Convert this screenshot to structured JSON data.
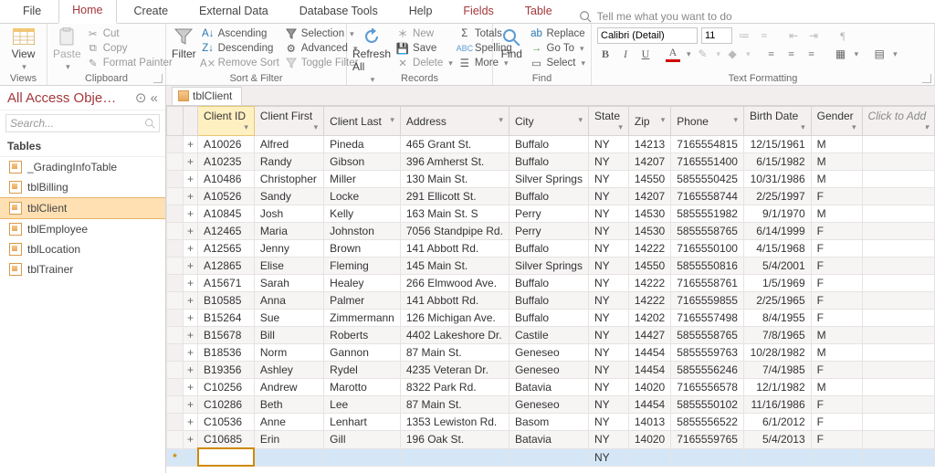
{
  "tabs": {
    "file": "File",
    "home": "Home",
    "create": "Create",
    "external": "External Data",
    "dbtools": "Database Tools",
    "help": "Help",
    "fields": "Fields",
    "table": "Table",
    "tellme": "Tell me what you want to do"
  },
  "ribbon": {
    "views": {
      "title": "Views",
      "view": "View"
    },
    "clipboard": {
      "title": "Clipboard",
      "paste": "Paste",
      "cut": "Cut",
      "copy": "Copy",
      "fp": "Format Painter"
    },
    "sortfilter": {
      "title": "Sort & Filter",
      "filter": "Filter",
      "asc": "Ascending",
      "desc": "Descending",
      "rs": "Remove Sort",
      "sel": "Selection",
      "adv": "Advanced",
      "tog": "Toggle Filter"
    },
    "records": {
      "title": "Records",
      "refresh": "Refresh All",
      "new": "New",
      "save": "Save",
      "delete": "Delete",
      "totals": "Totals",
      "spelling": "Spelling",
      "more": "More"
    },
    "find": {
      "title": "Find",
      "find": "Find",
      "replace": "Replace",
      "goto": "Go To",
      "select": "Select"
    },
    "fmt": {
      "title": "Text Formatting",
      "font": "Calibri (Detail)",
      "size": "11"
    }
  },
  "nav": {
    "title": "All Access Obje…",
    "search": "Search...",
    "section": "Tables",
    "items": [
      "_GradingInfoTable",
      "tblBilling",
      "tblClient",
      "tblEmployee",
      "tblLocation",
      "tblTrainer"
    ],
    "selected": 2
  },
  "docTab": "tblClient",
  "columns": [
    "Client ID",
    "Client First",
    "Client Last",
    "Address",
    "City",
    "State",
    "Zip",
    "Phone",
    "Birth Date",
    "Gender",
    "Click to Add"
  ],
  "rows": [
    {
      "id": "A10026",
      "first": "Alfred",
      "last": "Pineda",
      "addr": "465 Grant St.",
      "city": "Buffalo",
      "state": "NY",
      "zip": "14213",
      "phone": "7165554815",
      "bd": "12/15/1961",
      "g": "M"
    },
    {
      "id": "A10235",
      "first": "Randy",
      "last": "Gibson",
      "addr": "396 Amherst St.",
      "city": "Buffalo",
      "state": "NY",
      "zip": "14207",
      "phone": "7165551400",
      "bd": "6/15/1982",
      "g": "M"
    },
    {
      "id": "A10486",
      "first": "Christopher",
      "last": "Miller",
      "addr": "130 Main St.",
      "city": "Silver Springs",
      "state": "NY",
      "zip": "14550",
      "phone": "5855550425",
      "bd": "10/31/1986",
      "g": "M"
    },
    {
      "id": "A10526",
      "first": "Sandy",
      "last": "Locke",
      "addr": "291 Ellicott St.",
      "city": "Buffalo",
      "state": "NY",
      "zip": "14207",
      "phone": "7165558744",
      "bd": "2/25/1997",
      "g": "F"
    },
    {
      "id": "A10845",
      "first": "Josh",
      "last": "Kelly",
      "addr": "163 Main St. S",
      "city": "Perry",
      "state": "NY",
      "zip": "14530",
      "phone": "5855551982",
      "bd": "9/1/1970",
      "g": "M"
    },
    {
      "id": "A12465",
      "first": "Maria",
      "last": "Johnston",
      "addr": "7056 Standpipe Rd.",
      "city": "Perry",
      "state": "NY",
      "zip": "14530",
      "phone": "5855558765",
      "bd": "6/14/1999",
      "g": "F"
    },
    {
      "id": "A12565",
      "first": "Jenny",
      "last": "Brown",
      "addr": "141 Abbott Rd.",
      "city": "Buffalo",
      "state": "NY",
      "zip": "14222",
      "phone": "7165550100",
      "bd": "4/15/1968",
      "g": "F"
    },
    {
      "id": "A12865",
      "first": "Elise",
      "last": "Fleming",
      "addr": "145 Main St.",
      "city": "Silver Springs",
      "state": "NY",
      "zip": "14550",
      "phone": "5855550816",
      "bd": "5/4/2001",
      "g": "F"
    },
    {
      "id": "A15671",
      "first": "Sarah",
      "last": "Healey",
      "addr": "266 Elmwood Ave.",
      "city": "Buffalo",
      "state": "NY",
      "zip": "14222",
      "phone": "7165558761",
      "bd": "1/5/1969",
      "g": "F"
    },
    {
      "id": "B10585",
      "first": "Anna",
      "last": "Palmer",
      "addr": "141 Abbott Rd.",
      "city": "Buffalo",
      "state": "NY",
      "zip": "14222",
      "phone": "7165559855",
      "bd": "2/25/1965",
      "g": "F"
    },
    {
      "id": "B15264",
      "first": "Sue",
      "last": "Zimmermann",
      "addr": "126 Michigan Ave.",
      "city": "Buffalo",
      "state": "NY",
      "zip": "14202",
      "phone": "7165557498",
      "bd": "8/4/1955",
      "g": "F"
    },
    {
      "id": "B15678",
      "first": "Bill",
      "last": "Roberts",
      "addr": "4402 Lakeshore Dr.",
      "city": "Castile",
      "state": "NY",
      "zip": "14427",
      "phone": "5855558765",
      "bd": "7/8/1965",
      "g": "M"
    },
    {
      "id": "B18536",
      "first": "Norm",
      "last": "Gannon",
      "addr": "87 Main St.",
      "city": "Geneseo",
      "state": "NY",
      "zip": "14454",
      "phone": "5855559763",
      "bd": "10/28/1982",
      "g": "M"
    },
    {
      "id": "B19356",
      "first": "Ashley",
      "last": "Rydel",
      "addr": "4235 Veteran Dr.",
      "city": "Geneseo",
      "state": "NY",
      "zip": "14454",
      "phone": "5855556246",
      "bd": "7/4/1985",
      "g": "F"
    },
    {
      "id": "C10256",
      "first": "Andrew",
      "last": "Marotto",
      "addr": "8322 Park Rd.",
      "city": "Batavia",
      "state": "NY",
      "zip": "14020",
      "phone": "7165556578",
      "bd": "12/1/1982",
      "g": "M"
    },
    {
      "id": "C10286",
      "first": "Beth",
      "last": "Lee",
      "addr": "87 Main St.",
      "city": "Geneseo",
      "state": "NY",
      "zip": "14454",
      "phone": "5855550102",
      "bd": "11/16/1986",
      "g": "F"
    },
    {
      "id": "C10536",
      "first": "Anne",
      "last": "Lenhart",
      "addr": "1353 Lewiston Rd.",
      "city": "Basom",
      "state": "NY",
      "zip": "14013",
      "phone": "5855556522",
      "bd": "6/1/2012",
      "g": "F"
    },
    {
      "id": "C10685",
      "first": "Erin",
      "last": "Gill",
      "addr": "196 Oak St.",
      "city": "Batavia",
      "state": "NY",
      "zip": "14020",
      "phone": "7165559765",
      "bd": "5/4/2013",
      "g": "F"
    }
  ],
  "newRowState": "NY"
}
